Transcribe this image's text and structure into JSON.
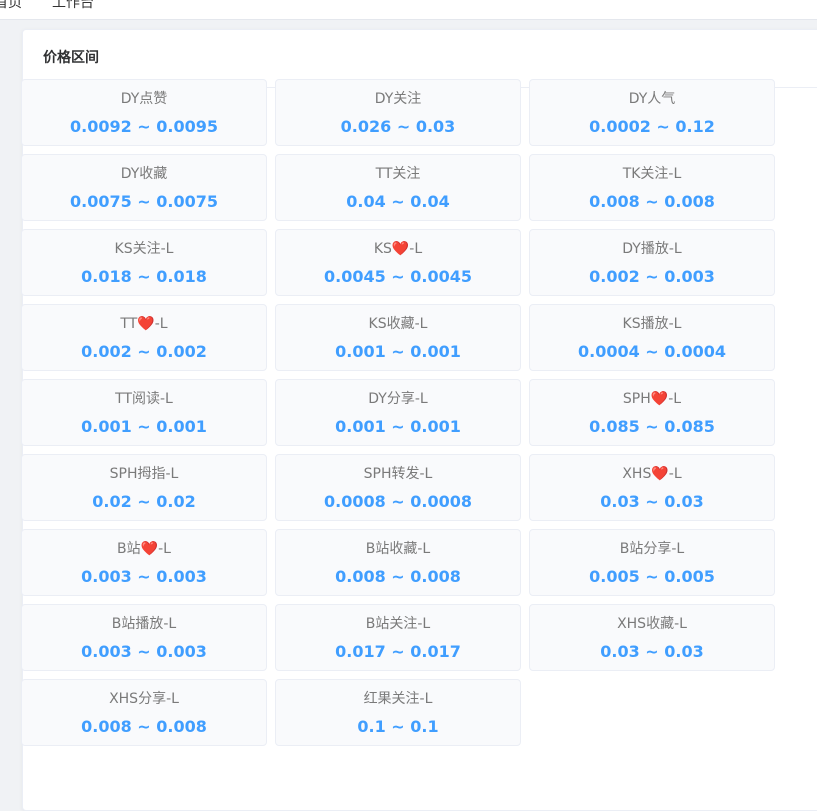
{
  "nav": {
    "tabs": [
      "首页",
      "工作台"
    ]
  },
  "panel": {
    "title": "价格区间"
  },
  "items": [
    {
      "name": "DY点赞",
      "range": "0.0092 ~ 0.0095"
    },
    {
      "name": "DY关注",
      "range": "0.026 ~ 0.03"
    },
    {
      "name": "DY人气",
      "range": "0.0002 ~ 0.12"
    },
    {
      "name": "DY收藏",
      "range": "0.0075 ~ 0.0075"
    },
    {
      "name": "TT关注",
      "range": "0.04 ~ 0.04"
    },
    {
      "name": "TK关注-L",
      "range": "0.008 ~ 0.008"
    },
    {
      "name": "KS关注-L",
      "range": "0.018 ~ 0.018"
    },
    {
      "name": "KS❤️-L",
      "range": "0.0045 ~ 0.0045"
    },
    {
      "name": "DY播放-L",
      "range": "0.002 ~ 0.003"
    },
    {
      "name": "TT❤️-L",
      "range": "0.002 ~ 0.002"
    },
    {
      "name": "KS收藏-L",
      "range": "0.001 ~ 0.001"
    },
    {
      "name": "KS播放-L",
      "range": "0.0004 ~ 0.0004"
    },
    {
      "name": "TT阅读-L",
      "range": "0.001 ~ 0.001"
    },
    {
      "name": "DY分享-L",
      "range": "0.001 ~ 0.001"
    },
    {
      "name": "SPH❤️-L",
      "range": "0.085 ~ 0.085"
    },
    {
      "name": "SPH拇指-L",
      "range": "0.02 ~ 0.02"
    },
    {
      "name": "SPH转发-L",
      "range": "0.0008 ~ 0.0008"
    },
    {
      "name": "XHS❤️-L",
      "range": "0.03 ~ 0.03"
    },
    {
      "name": "B站❤️-L",
      "range": "0.003 ~ 0.003"
    },
    {
      "name": "B站收藏-L",
      "range": "0.008 ~ 0.008"
    },
    {
      "name": "B站分享-L",
      "range": "0.005 ~ 0.005"
    },
    {
      "name": "B站播放-L",
      "range": "0.003 ~ 0.003"
    },
    {
      "name": "B站关注-L",
      "range": "0.017 ~ 0.017"
    },
    {
      "name": "XHS收藏-L",
      "range": "0.03 ~ 0.03"
    },
    {
      "name": "XHS分享-L",
      "range": "0.008 ~ 0.008"
    },
    {
      "name": "红果关注-L",
      "range": "0.1 ~ 0.1"
    }
  ]
}
